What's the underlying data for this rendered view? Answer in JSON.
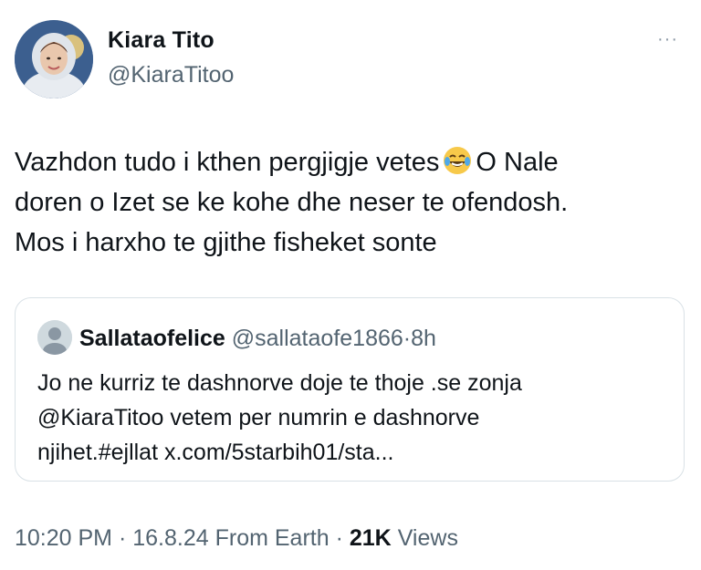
{
  "author": {
    "display_name": "Kiara Tito",
    "handle": "@KiaraTitoo"
  },
  "more_label": "···",
  "tweet": {
    "line1_before": "Vazhdon tudo i kthen pergjigje vetes",
    "emoji": "laughing-tears-emoji",
    "line1_after": "O Nale",
    "line2": "doren o Izet se ke kohe dhe neser te ofendosh.",
    "line3": "Mos i harxho te gjithe fisheket sonte"
  },
  "quote": {
    "display_name": "Sallataofelice",
    "handle": "@sallataofe1866",
    "dot": "·",
    "time": "8h",
    "text": "Jo ne kurriz te dashnorve doje te thoje .se zonja\n@KiaraTitoo vetem per numrin e dashnorve\nnjihet.#ejllat x.com/5starbih01/sta..."
  },
  "footer": {
    "time": "10:20 PM",
    "sep1": "·",
    "date": "16.8.24 From Earth",
    "sep2": "·",
    "views_count": "21K",
    "views_label": "Views"
  },
  "colors": {
    "text": "#0f1419",
    "secondary": "#536471",
    "border": "#d9e1e6"
  }
}
